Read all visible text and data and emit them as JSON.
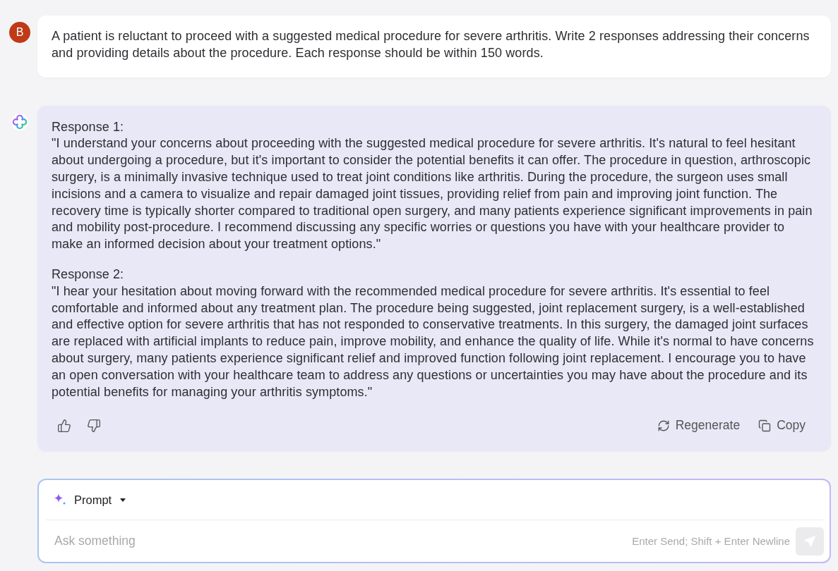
{
  "user_message": {
    "avatar_letter": "B",
    "text": "A patient is reluctant to proceed with a suggested medical procedure for severe arthritis. Write 2 responses addressing their concerns and providing details about the procedure. Each response should be within 150 words."
  },
  "assistant_message": {
    "responses": [
      {
        "label": "Response 1:",
        "text": "\"I understand your concerns about proceeding with the suggested medical procedure for severe arthritis. It's natural to feel hesitant about undergoing a procedure, but it's important to consider the potential benefits it can offer. The procedure in question, arthroscopic surgery, is a minimally invasive technique used to treat joint conditions like arthritis. During the procedure, the surgeon uses small incisions and a camera to visualize and repair damaged joint tissues, providing relief from pain and improving joint function. The recovery time is typically shorter compared to traditional open surgery, and many patients experience significant improvements in pain and mobility post-procedure. I recommend discussing any specific worries or questions you have with your healthcare provider to make an informed decision about your treatment options.\""
      },
      {
        "label": "Response 2:",
        "text": "\"I hear your hesitation about moving forward with the recommended medical procedure for severe arthritis. It's essential to feel comfortable and informed about any treatment plan. The procedure being suggested, joint replacement surgery, is a well-established and effective option for severe arthritis that has not responded to conservative treatments. In this surgery, the damaged joint surfaces are replaced with artificial implants to reduce pain, improve mobility, and enhance the quality of life. While it's normal to have concerns about surgery, many patients experience significant relief and improved function following joint replacement. I encourage you to have an open conversation with your healthcare team to address any questions or uncertainties you may have about the procedure and its potential benefits for managing your arthritis symptoms.\""
      }
    ],
    "actions": [
      {
        "kind": "regenerate",
        "label": "Regenerate"
      },
      {
        "kind": "copy",
        "label": "Copy"
      }
    ]
  },
  "composer": {
    "mode_label": "Prompt",
    "placeholder": "Ask something",
    "hint": "Enter Send; Shift + Enter Newline",
    "send_disabled": true
  }
}
